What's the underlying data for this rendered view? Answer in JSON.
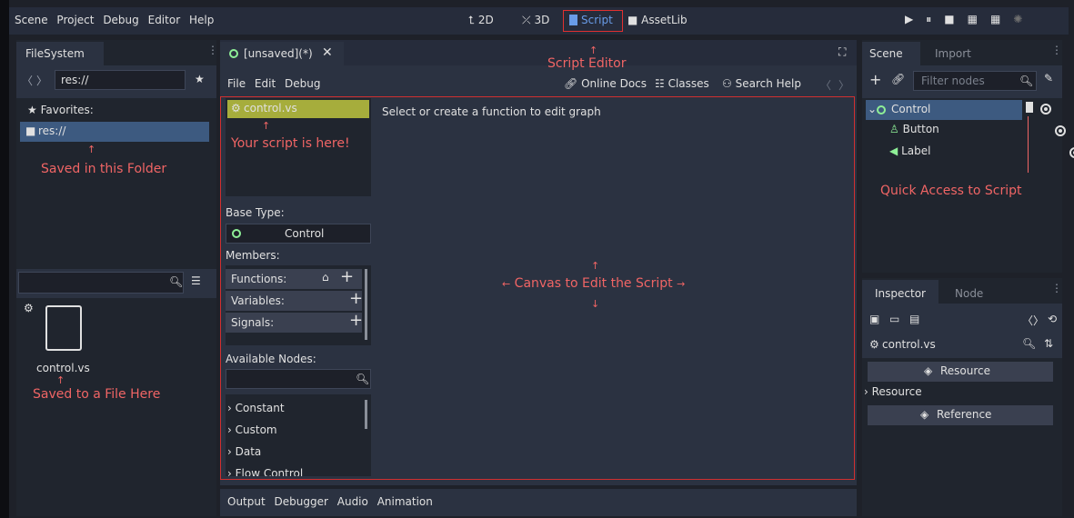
{
  "menu": [
    "Scene",
    "Project",
    "Debug",
    "Editor",
    "Help"
  ],
  "workspaces": {
    "d2": "2D",
    "d3": "3D",
    "script": "Script",
    "assetlib": "AssetLib"
  },
  "filesystem": {
    "tab": "FileSystem",
    "path": "res://",
    "favorites": "Favorites:",
    "folder": "res://",
    "file": "control.vs",
    "note_folder": "Saved in this Folder",
    "note_file": "Saved to a File Here"
  },
  "script_editor": {
    "tab": "[unsaved](*)",
    "annotation": "Script Editor",
    "menu": [
      "File",
      "Edit",
      "Debug"
    ],
    "online_docs": "Online Docs",
    "classes": "Classes",
    "search_help": "Search Help",
    "script_item": "control.vs",
    "script_note": "Your script is here!",
    "hint": "Select or create a function to edit graph",
    "base_type_label": "Base Type:",
    "base_type_value": "Control",
    "members_label": "Members:",
    "functions": "Functions:",
    "variables": "Variables:",
    "signals": "Signals:",
    "available_nodes": "Available Nodes:",
    "node_categories": [
      "Constant",
      "Custom",
      "Data",
      "Flow Control"
    ],
    "canvas_note": "Canvas to Edit the Script"
  },
  "scene": {
    "tab_scene": "Scene",
    "tab_import": "Import",
    "filter_placeholder": "Filter nodes",
    "nodes": [
      "Control",
      "Button",
      "Label"
    ],
    "note": "Quick Access to Script"
  },
  "inspector": {
    "tab_inspector": "Inspector",
    "tab_node": "Node",
    "object": "control.vs",
    "resource_header": "Resource",
    "resource_row": "Resource",
    "reference": "Reference"
  },
  "bottom": [
    "Output",
    "Debugger",
    "Audio",
    "Animation"
  ],
  "colors": {
    "accent": "#699ce8",
    "annotation": "#f06565",
    "selected": "#a6ad3c"
  }
}
